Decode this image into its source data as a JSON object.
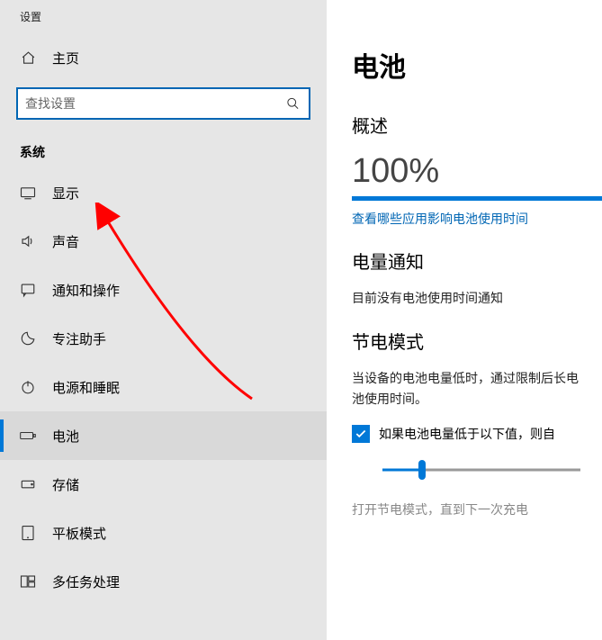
{
  "appTitle": "设置",
  "home": "主页",
  "searchPlaceholder": "查找设置",
  "groupTitle": "系统",
  "nav": {
    "display": "显示",
    "sound": "声音",
    "notifications": "通知和操作",
    "focus": "专注助手",
    "power": "电源和睡眠",
    "battery": "电池",
    "storage": "存储",
    "tablet": "平板模式",
    "multitask": "多任务处理"
  },
  "page": {
    "title": "电池",
    "overview": "概述",
    "percent": "100%",
    "link": "查看哪些应用影响电池使用时间",
    "notifyTitle": "电量通知",
    "notifyText": "目前没有电池使用时间通知",
    "saverTitle": "节电模式",
    "saverDesc": "当设备的电池电量低时，通过限制后长电池使用时间。",
    "checkboxLabel": "如果电池电量低于以下值，则自",
    "footnote": "打开节电模式，直到下一次充电"
  }
}
